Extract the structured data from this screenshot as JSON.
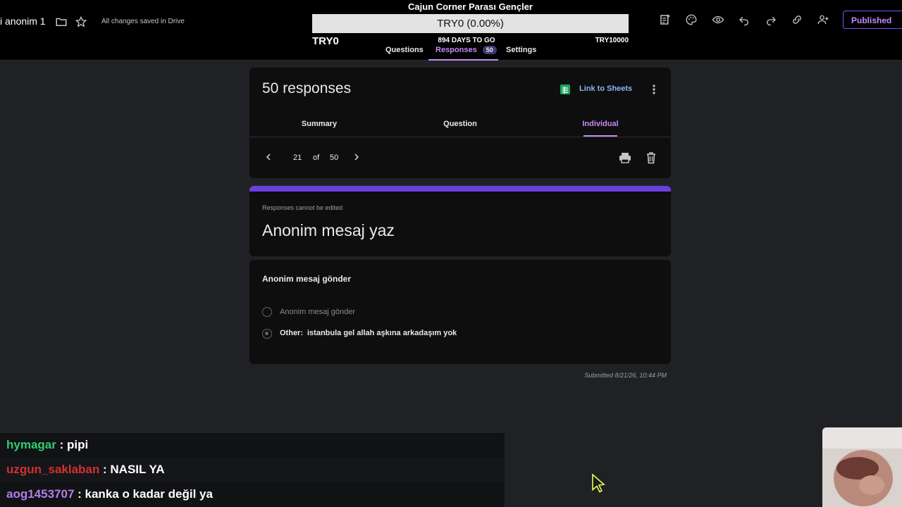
{
  "header": {
    "doc_title": "i anonim 1",
    "saved_status": "All changes saved in Drive",
    "published_label": "Published"
  },
  "goal": {
    "title": "Cajun Corner Parası Gençler",
    "progress_text": "TRY0 (0.00%)",
    "progress_fraction": 0.0,
    "start_amount": "TRY0",
    "days_left": "894 DAYS TO GO",
    "target_amount": "TRY10000"
  },
  "top_tabs": {
    "questions": "Questions",
    "responses": "Responses",
    "responses_badge": "50",
    "settings": "Settings"
  },
  "responses": {
    "count_label": "50 responses",
    "link_sheets": "Link to Sheets",
    "subtabs": {
      "summary": "Summary",
      "question": "Question",
      "individual": "Individual"
    },
    "nav": {
      "current": "21",
      "of": "of",
      "total": "50"
    }
  },
  "form": {
    "note": "Responses cannot be edited",
    "title": "Anonim mesaj yaz"
  },
  "question": {
    "title": "Anonim mesaj gönder",
    "option1": "Anonim mesaj gönder",
    "other_label": "Other:",
    "other_value": "istanbula gel allah aşkına arkadaşım yok"
  },
  "submitted": "Submitted 8/21/26, 10:44 PM",
  "chat": [
    {
      "user": "hymagar",
      "color": "#2ecc71",
      "message": ": pipi"
    },
    {
      "user": "uzgun_saklaban",
      "color": "#d63031",
      "message": ": NASIL YA"
    },
    {
      "user": "aog1453707",
      "color": "#b37feb",
      "message": ": kanka o kadar değil ya"
    }
  ],
  "icons": {
    "folder": "folder-icon",
    "star": "star-icon",
    "customize": "customize-icon",
    "palette": "palette-icon",
    "preview": "eye-icon",
    "undo": "undo-icon",
    "redo": "redo-icon",
    "link": "link-icon",
    "add_collaborator": "add-person-icon",
    "sheets": "sheets-icon",
    "more": "more-vert-icon",
    "print": "print-icon",
    "delete": "trash-icon"
  },
  "colors": {
    "accent": "#c58af9",
    "header_bar": "#6a3fe0",
    "sheets_green": "#1fa463",
    "link_blue": "#8ab4f8"
  }
}
